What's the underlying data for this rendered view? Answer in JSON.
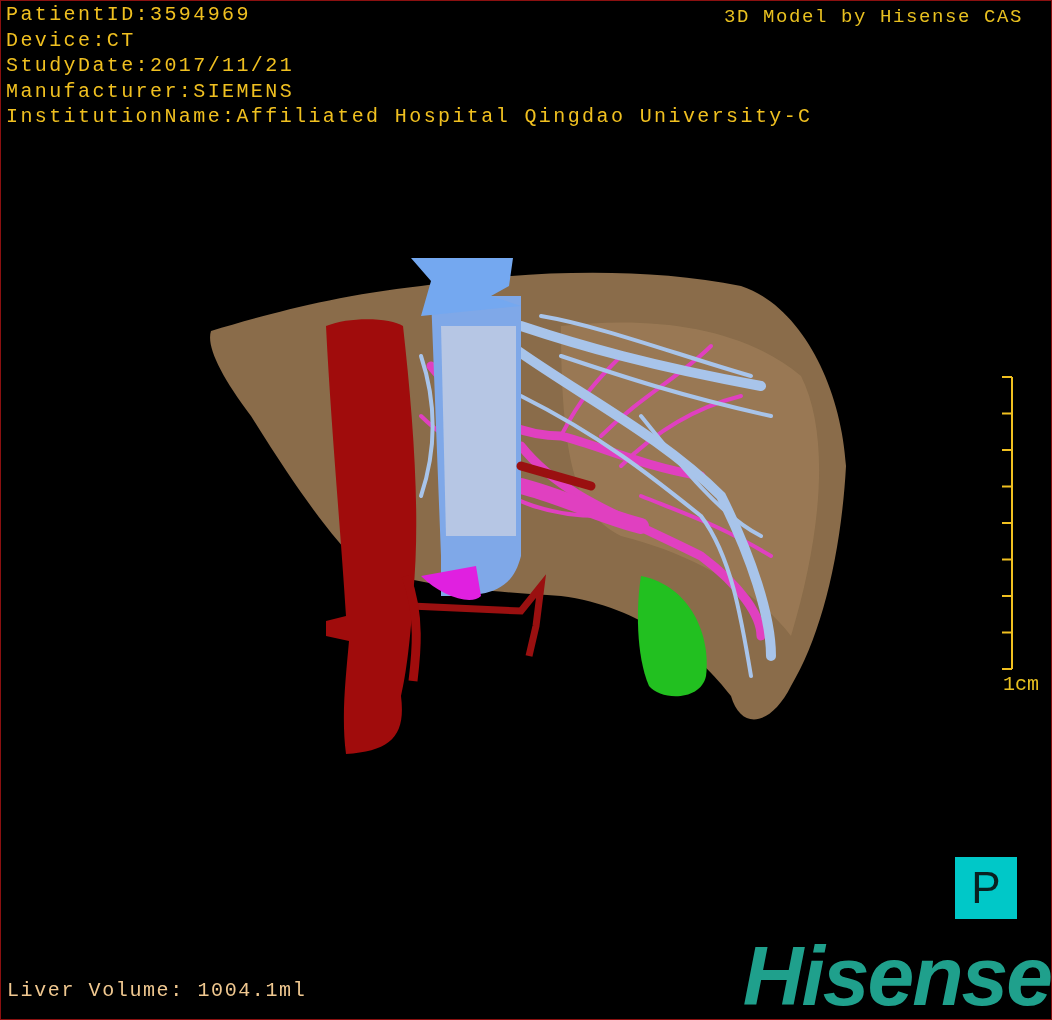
{
  "patient_info": [
    "PatientID:3594969",
    "Device:CT",
    "StudyDate:2017/11/21",
    "Manufacturer:SIEMENS",
    "InstitutionName:Affiliated Hospital Qingdao University-C"
  ],
  "title": "3D Model by Hisense CAS",
  "scale_bar": {
    "label": "1cm"
  },
  "view_orientation": "P",
  "liver_volume": "Liver Volume: 1004.1ml",
  "logo": "Hisense"
}
